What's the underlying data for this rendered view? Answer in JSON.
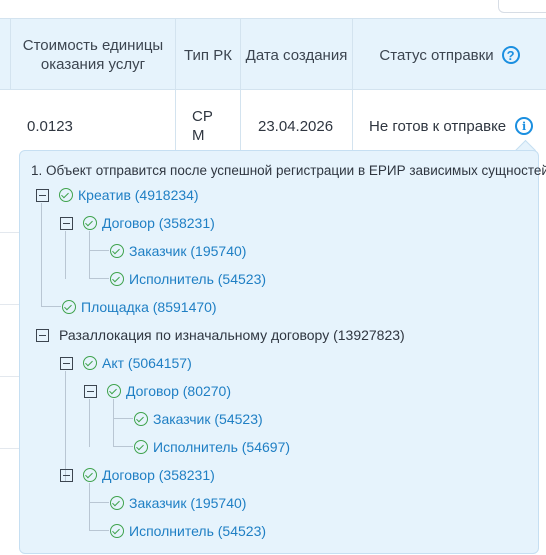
{
  "table": {
    "headers": {
      "cost": "Стоимость единицы оказания услуг",
      "rk_type": "Тип РК",
      "created": "Дата создания",
      "status": "Статус отправки"
    },
    "row": {
      "cost": "0.0123",
      "rk_type": "СРМ",
      "created": "23.04.2026",
      "status": "Не готов к отправке"
    }
  },
  "popover": {
    "title": "1. Объект отправится после успешной регистрации в ЕРИР зависимых сущностей",
    "tree": [
      {
        "label": "Креатив (4918234)",
        "check": true,
        "toggle": true
      },
      {
        "label": "Договор (358231)",
        "check": true,
        "toggle": true
      },
      {
        "label": "Заказчик (195740)",
        "check": true,
        "toggle": false
      },
      {
        "label": "Исполнитель (54523)",
        "check": true,
        "toggle": false
      },
      {
        "label": "Площадка (8591470)",
        "check": true,
        "toggle": false
      },
      {
        "label": "Разаллокация по изначальному договору (13927823)",
        "check": false,
        "toggle": true
      },
      {
        "label": "Акт (5064157)",
        "check": true,
        "toggle": true
      },
      {
        "label": "Договор (80270)",
        "check": true,
        "toggle": true
      },
      {
        "label": "Заказчик (54523)",
        "check": true,
        "toggle": false
      },
      {
        "label": "Исполнитель (54697)",
        "check": true,
        "toggle": false
      },
      {
        "label": "Договор (358231)",
        "check": true,
        "toggle": true
      },
      {
        "label": "Заказчик (195740)",
        "check": true,
        "toggle": false
      },
      {
        "label": "Исполнитель (54523)",
        "check": true,
        "toggle": false
      }
    ]
  },
  "colors": {
    "header_bg": "#e6f3fc",
    "accent": "#1b8fe0",
    "link": "#1f7fc4",
    "success": "#3fa34d"
  },
  "icons": {
    "help": "question-circle-icon",
    "info": "info-circle-icon",
    "collapse": "minus-square-icon",
    "ok": "check-circle-icon"
  }
}
